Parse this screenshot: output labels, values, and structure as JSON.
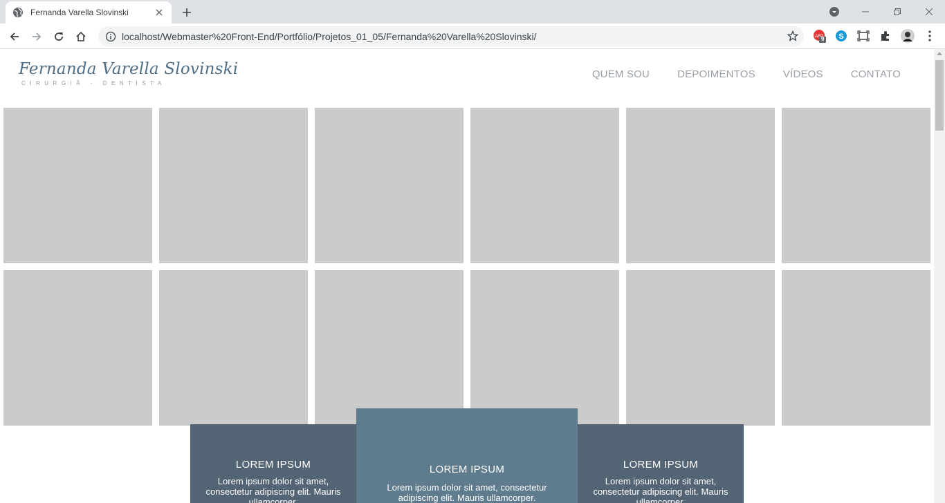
{
  "browser": {
    "tab_title": "Fernanda Varella Slovinski",
    "url": "localhost/Webmaster%20Front-End/Portfólio/Projetos_01_05/Fernanda%20Varella%20Slovinski/",
    "extension_badge": "9",
    "icons": [
      "globe-icon",
      "close-icon",
      "plus-icon",
      "back-icon",
      "forward-icon",
      "reload-icon",
      "home-icon",
      "info-icon",
      "star-icon",
      "adblock-icon",
      "skype-icon",
      "screenshot-icon",
      "puzzle-icon",
      "avatar",
      "kebab-menu-icon",
      "minimize-icon",
      "restore-icon",
      "window-close-icon"
    ]
  },
  "site": {
    "logo_name": "Fernanda Varella Slovinski",
    "logo_sub": "CIRURGIÃ - DENTISTA",
    "nav": [
      "QUEM SOU",
      "DEPOIMENTOS",
      "VÍDEOS",
      "CONTATO"
    ],
    "tile_color": "#cbcbcb",
    "cards": [
      {
        "title": "LOREM IPSUM",
        "text": "Lorem ipsum dolor sit amet, consectetur adipiscing elit. Mauris ullamcorper."
      },
      {
        "title": "LOREM IPSUM",
        "text": "Lorem ipsum dolor sit amet, consectetur adipiscing elit. Mauris ullamcorper."
      },
      {
        "title": "LOREM IPSUM",
        "text": "Lorem ipsum dolor sit amet, consectetur adipiscing elit. Mauris ullamcorper."
      }
    ],
    "card_colors": {
      "side": "#536574",
      "center": "#5f7b8e"
    }
  }
}
